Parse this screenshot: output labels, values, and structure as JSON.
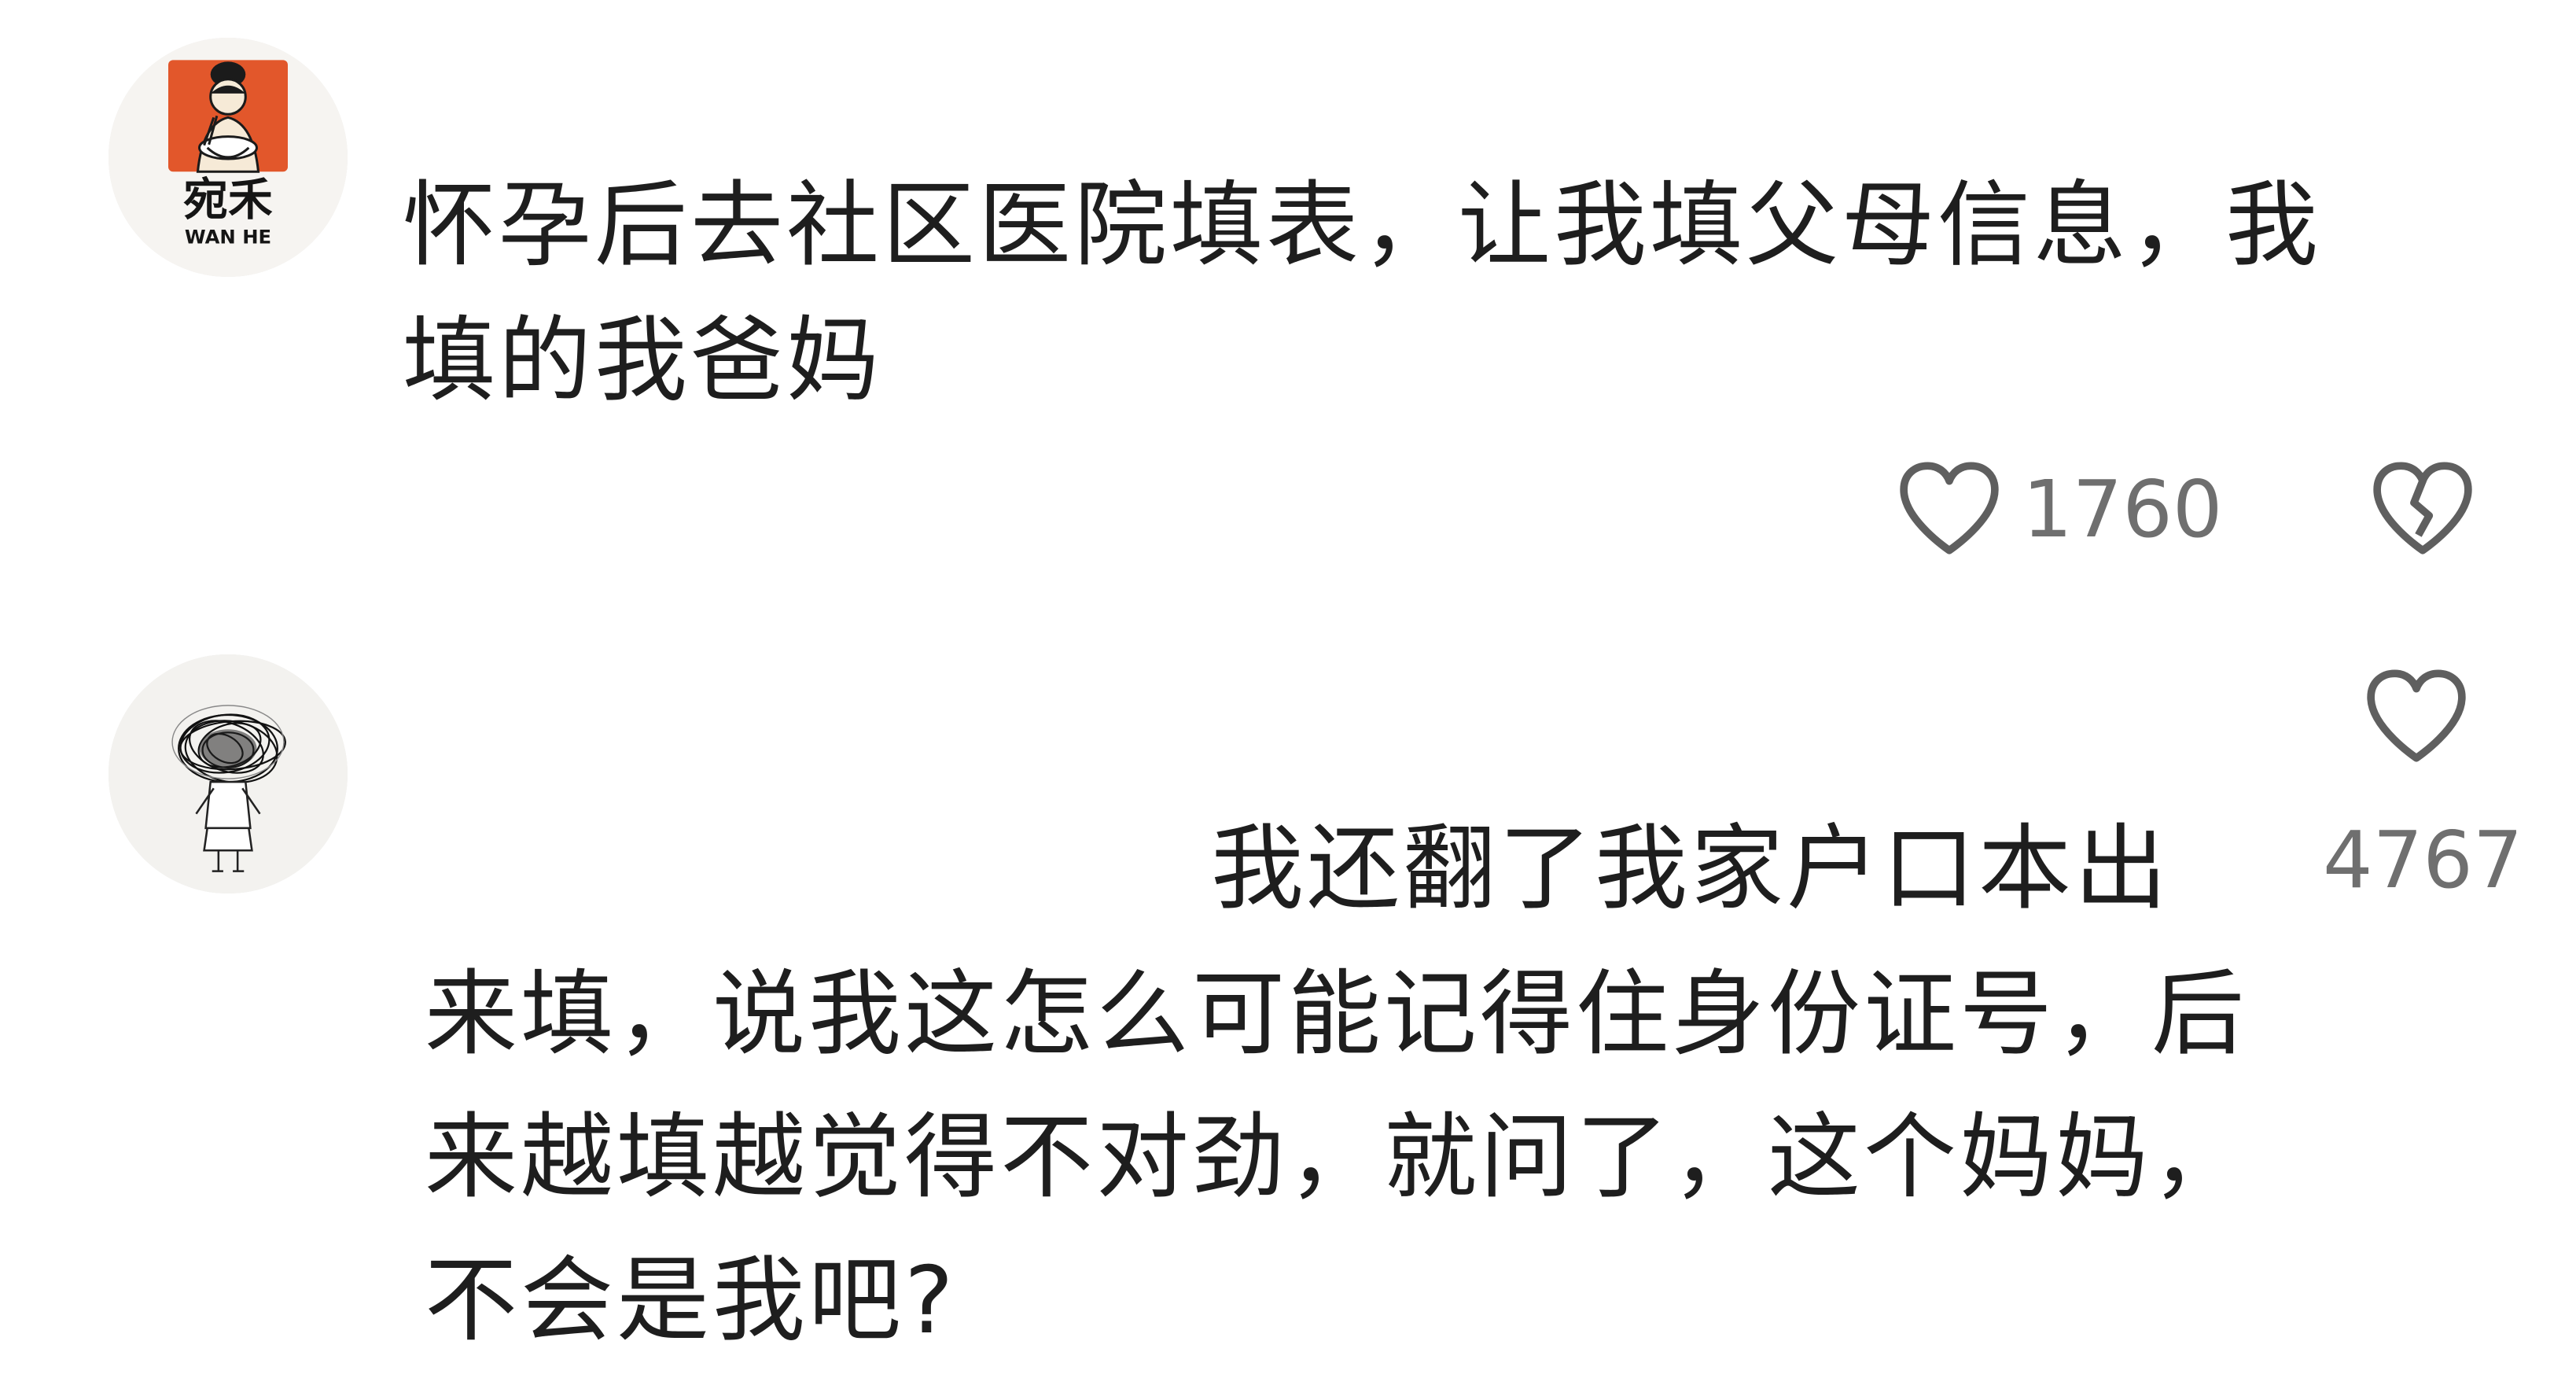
{
  "comments": [
    {
      "avatar": {
        "kind": "brand-logo",
        "logo_text": "宛禾",
        "logo_subtext": "WAN HE",
        "brand_color": "#e2572b"
      },
      "text": "怀孕后去社区医院填表，让我填父母信息，我\n填的我爸妈",
      "likes": "1760",
      "dislike_icon": "broken-heart-icon"
    },
    {
      "avatar": {
        "kind": "scribble-head-drawing"
      },
      "text_first_line": "我还翻了我家户口本出",
      "text_rest": "来填，说我这怎么可能记得住身份证号，后\n来越填越觉得不对劲，就问了，这个妈妈，\n不会是我吧?",
      "likes": "4767"
    }
  ],
  "colors": {
    "text": "#1e1e1e",
    "meta": "#6f6f6f",
    "icon_stroke": "#5f5f5f"
  }
}
